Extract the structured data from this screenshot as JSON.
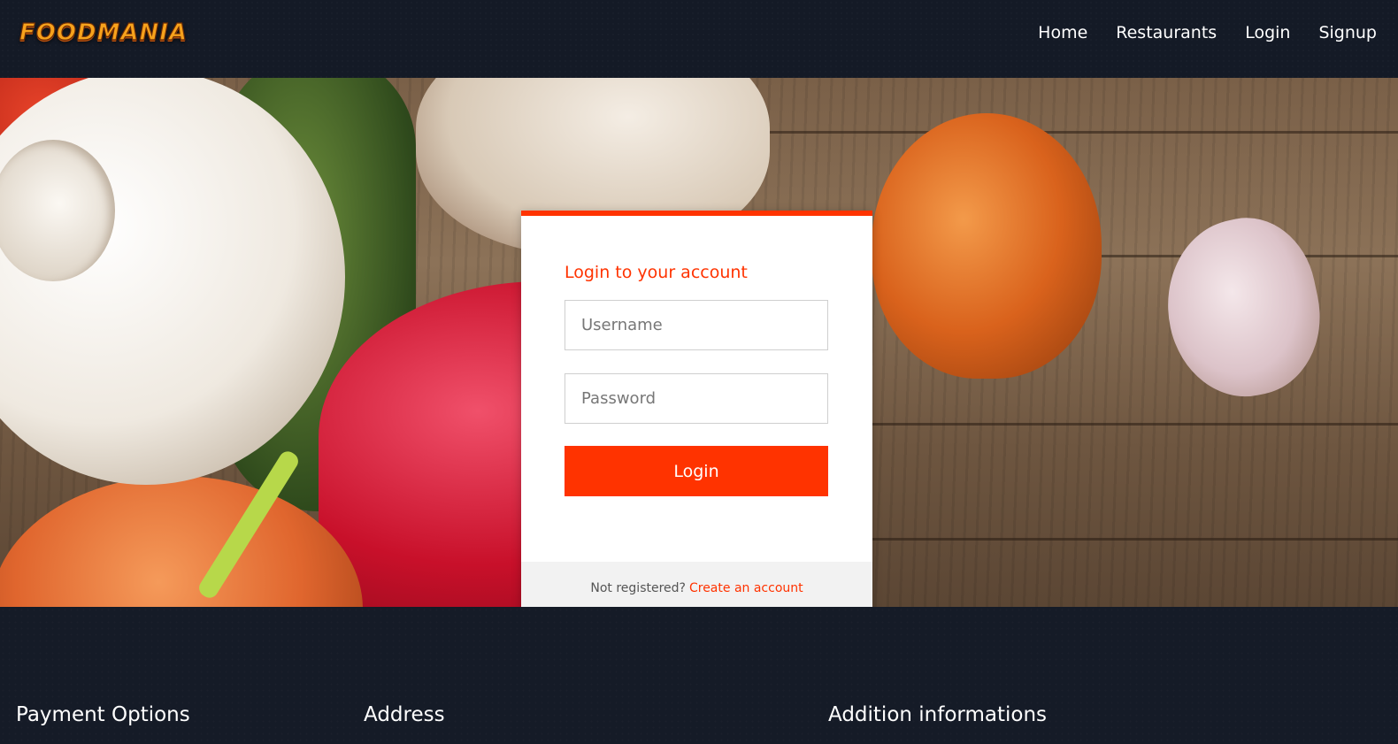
{
  "header": {
    "logo_text": "FOODMANIA",
    "nav": [
      {
        "label": "Home"
      },
      {
        "label": "Restaurants"
      },
      {
        "label": "Login"
      },
      {
        "label": "Signup"
      }
    ]
  },
  "login_card": {
    "title": "Login to your account",
    "username_placeholder": "Username",
    "password_placeholder": "Password",
    "submit_label": "Login",
    "footer_text": "Not registered?",
    "footer_link": "Create an account"
  },
  "footer": {
    "headings": [
      "Payment Options",
      "Address",
      "Addition informations"
    ]
  },
  "colors": {
    "accent": "#ff3300",
    "background": "#151b27",
    "logo": "#f7a21c"
  }
}
